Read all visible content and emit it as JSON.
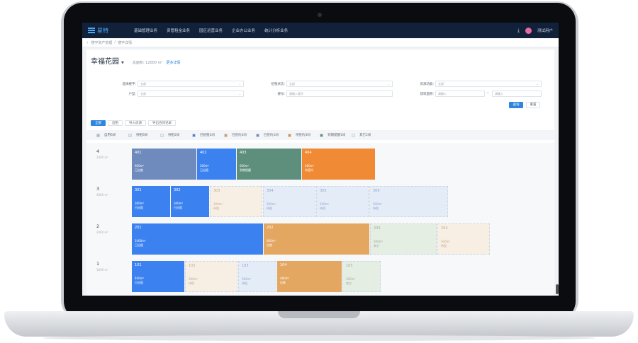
{
  "nav": {
    "logo": "星特",
    "menu": [
      "基础管理业务",
      "资管租金业务",
      "园区运营业务",
      "企业办公业务",
      "统计分析业务"
    ],
    "user": "测试用户"
  },
  "breadcrumb": [
    "楼宇资产管理",
    "楼宇详情"
  ],
  "building": {
    "title": "幸福花园",
    "subtitle": "总面积: 12000 m²",
    "more_link": "更多详情"
  },
  "filters": {
    "row1": [
      {
        "label": "选择楼宇:",
        "value": "全部"
      },
      {
        "label": "招租状态:",
        "value": "全部"
      },
      {
        "label": "房源功能:",
        "value": "全部"
      }
    ],
    "row2": [
      {
        "label": "户型:",
        "value": "全部"
      },
      {
        "label": "楼号:",
        "placeholder": "请输入楼号"
      },
      {
        "label": "建筑面积:",
        "placeholder_min": "请输入",
        "placeholder_max": "请输入"
      }
    ],
    "search_label": "查询",
    "reset_label": "重置"
  },
  "tabs": [
    "全部",
    "出租",
    "导入房源",
    "导出合同记录"
  ],
  "legend": [
    {
      "label": "自用6间",
      "color": "#b5b8bd",
      "fill": true
    },
    {
      "label": "待租6间",
      "color": "#d9e6f7",
      "fill": true
    },
    {
      "label": "待租2间",
      "color": "#f6ecdd",
      "fill": true
    },
    {
      "label": "已招租2间",
      "color": "#3d7fe0",
      "fill": true
    },
    {
      "label": "已签约3间",
      "color": "#e09a55",
      "fill": true
    },
    {
      "label": "已签约1间",
      "color": "#6c86c6",
      "fill": true
    },
    {
      "label": "待签约3间",
      "color": "#f08a34",
      "fill": true
    },
    {
      "label": "到期提醒1间",
      "color": "#5d8c74",
      "fill": true
    },
    {
      "label": "其它2间",
      "color": "#eceff2",
      "fill": true
    }
  ],
  "floors": [
    {
      "number": "4",
      "area": "2400 m²",
      "units": [
        {
          "name": "401",
          "area": "600m²",
          "status": "已出售",
          "color": "#6f8bbd",
          "style": "s-occupied"
        },
        {
          "name": "402",
          "area": "300m²",
          "status": "已出租",
          "color": "#3b82f0",
          "style": "s-occupied"
        },
        {
          "name": "403",
          "area": "600m²",
          "status": "到期提醒",
          "color": "#5d8f7c",
          "style": "s-occupied"
        },
        {
          "name": "404",
          "area": "480m²",
          "status": "待签约",
          "color": "#f08a34",
          "style": "s-occupied"
        }
      ]
    },
    {
      "number": "3",
      "area": "2800 m²",
      "units": [
        {
          "name": "301",
          "area": "300m²",
          "status": "已出租",
          "color": "#3b82f0",
          "style": "s-occupied"
        },
        {
          "name": "302",
          "area": "300m²",
          "status": "已出租",
          "color": "#3b82f0",
          "style": "s-occupied"
        },
        {
          "name": "303",
          "area": "300m²",
          "status": "待租",
          "color": "#f7efe4",
          "style": "s-empty"
        },
        {
          "name": "304",
          "area": "300m²",
          "status": "待租",
          "color": "#e4ecf8",
          "style": "s-empty-blue"
        },
        {
          "name": "305",
          "area": "500m²",
          "status": "待租",
          "color": "#e4ecf8",
          "style": "s-empty-blue"
        },
        {
          "name": "306",
          "area": "500m²",
          "status": "待租",
          "color": "#e4ecf8",
          "style": "s-empty-blue"
        }
      ]
    },
    {
      "number": "2",
      "area": "2400 m²",
      "units": [
        {
          "name": "201",
          "area": "1000m²",
          "status": "已出租",
          "color": "#3b82f0",
          "style": "s-occupied"
        },
        {
          "name": "202",
          "area": "800m²",
          "status": "出售",
          "color": "#e3a762",
          "style": "s-occupied"
        },
        {
          "name": "203",
          "area": "300m²",
          "status": "其它",
          "color": "#e5eee2",
          "style": "s-empty-green"
        },
        {
          "name": "204",
          "area": "300m²",
          "status": "待租",
          "color": "#f7efe4",
          "style": "s-empty"
        }
      ]
    },
    {
      "number": "1",
      "area": "1600 m²",
      "units": [
        {
          "name": "101",
          "area": "400m²",
          "status": "已出租",
          "color": "#3b82f0",
          "style": "s-occupied"
        },
        {
          "name": "102",
          "area": "300m²",
          "status": "待租",
          "color": "#f7efe4",
          "style": "s-empty"
        },
        {
          "name": "103",
          "area": "300m²",
          "status": "待租",
          "color": "#e4ecf8",
          "style": "s-empty-blue"
        },
        {
          "name": "104",
          "area": "480m²",
          "status": "出售",
          "color": "#e3a762",
          "style": "s-occupied"
        },
        {
          "name": "105",
          "area": "200m²",
          "status": "其它",
          "color": "#e5eee2",
          "style": "s-empty-green"
        }
      ]
    }
  ]
}
